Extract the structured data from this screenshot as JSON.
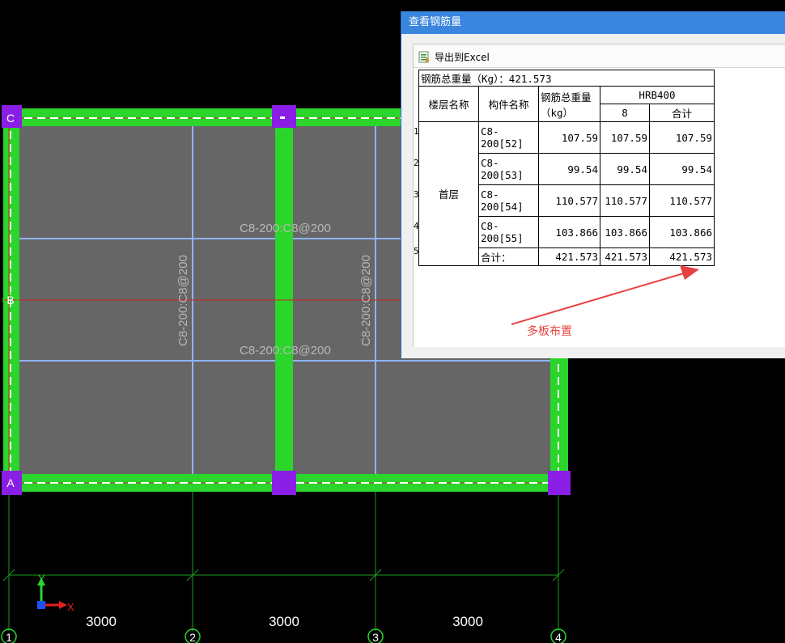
{
  "cad": {
    "slab_labels": [
      "C8-200:C8@200",
      "C8-200:C8@200"
    ],
    "vertical_labels": [
      "C8-200:C8@200",
      "C8-200:C8@200"
    ],
    "axis_letters": [
      "C",
      "B",
      "A"
    ],
    "axis_numbers": [
      "1",
      "2",
      "3",
      "4"
    ],
    "dimensions": [
      "3000",
      "3000",
      "3000"
    ],
    "ucs_y": "Y",
    "ucs_x": "X"
  },
  "dialog": {
    "title": "查看钢筋量",
    "export_label": "导出到Excel",
    "total_weight_caption": "钢筋总重量（Kg）：421.573",
    "headers": {
      "floor": "楼层名称",
      "component": "构件名称",
      "total": "钢筋总重量（kg）",
      "grade": "HRB400",
      "dia": "8",
      "sum": "合计"
    },
    "floor_name": "首层",
    "rows": [
      {
        "num": "1",
        "component": "C8-200[52]",
        "total": "107.59",
        "d8": "107.59",
        "sum": "107.59"
      },
      {
        "num": "2",
        "component": "C8-200[53]",
        "total": "99.54",
        "d8": "99.54",
        "sum": "99.54"
      },
      {
        "num": "3",
        "component": "C8-200[54]",
        "total": "110.577",
        "d8": "110.577",
        "sum": "110.577"
      },
      {
        "num": "4",
        "component": "C8-200[55]",
        "total": "103.866",
        "d8": "103.866",
        "sum": "103.866"
      },
      {
        "num": "5",
        "component": "合计：",
        "total": "421.573",
        "d8": "421.573",
        "sum": "421.573"
      }
    ]
  },
  "annotation": "多板布置",
  "colors": {
    "beam": "#2bd52b",
    "column": "#8a1ee6",
    "slab": "#666666",
    "rebar_line": "#8fb4ff",
    "axis_line": "#d02020",
    "grid": "#1e9a1e",
    "arrow": "#e84141"
  }
}
